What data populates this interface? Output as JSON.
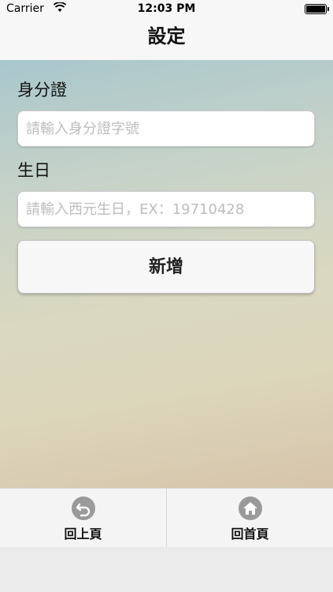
{
  "status_bar": {
    "carrier": "Carrier",
    "time": "12:03 PM"
  },
  "nav": {
    "title": "設定"
  },
  "form": {
    "id_label": "身分證",
    "id_placeholder": "請輸入身分證字號",
    "birthday_label": "生日",
    "birthday_placeholder": "請輸入西元生日，EX：19710428",
    "add_label": "新增"
  },
  "tab_bar": {
    "back_label": "回上頁",
    "home_label": "回首頁"
  },
  "icons": {
    "back": "back-arrow-circle",
    "home": "house-circle",
    "wifi": "wifi-signal",
    "battery": "battery-full"
  }
}
